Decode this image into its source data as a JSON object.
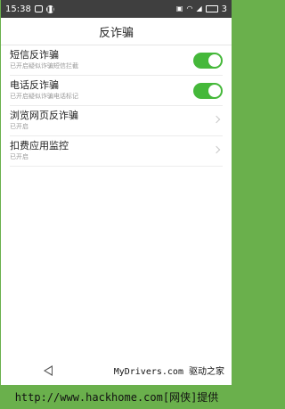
{
  "status_bar": {
    "time": "15:38",
    "badge": "3",
    "icons": [
      "message-icon",
      "music-icon",
      "wifi-icon",
      "signal-icon",
      "battery-icon"
    ]
  },
  "header": {
    "title": "反诈骗"
  },
  "settings": [
    {
      "title": "短信反诈骗",
      "subtitle": "已开启疑似诈骗短信拦截",
      "control": "toggle",
      "on": true
    },
    {
      "title": "电话反诈骗",
      "subtitle": "已开启疑似诈骗电话标记",
      "control": "toggle",
      "on": true
    },
    {
      "title": "浏览网页反诈骗",
      "subtitle": "已开启",
      "control": "chevron"
    },
    {
      "title": "扣费应用监控",
      "subtitle": "已开启",
      "control": "chevron"
    }
  ],
  "watermark": "MyDrivers.com 驱动之家",
  "footer": "http://www.hackhome.com[网侠]提供",
  "colors": {
    "accent": "#45b83a",
    "status_bar": "#3f3f3f",
    "footer": "#6ab04c"
  }
}
